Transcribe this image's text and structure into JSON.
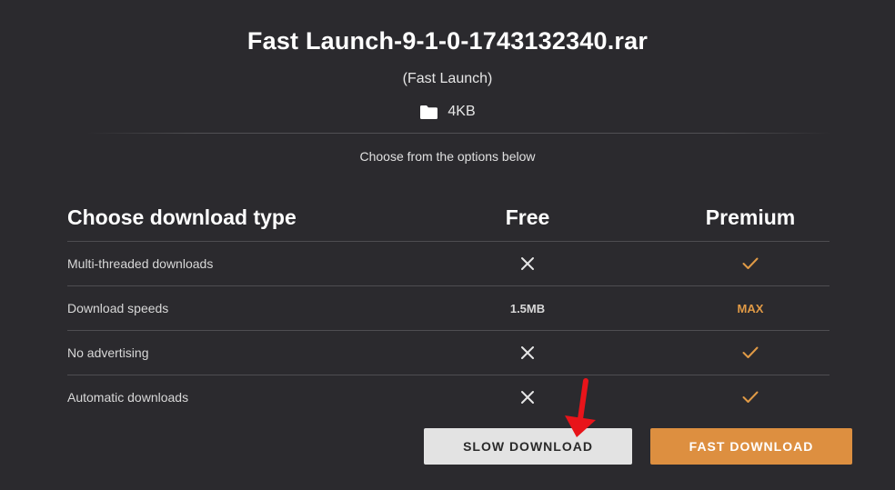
{
  "file": {
    "title": "Fast Launch-9-1-0-1743132340.rar",
    "subtitle": "(Fast Launch)",
    "size": "4KB"
  },
  "choose_text": "Choose from the options below",
  "table": {
    "header": {
      "label": "Choose download type",
      "free": "Free",
      "premium": "Premium"
    },
    "rows": [
      {
        "label": "Multi-threaded downloads",
        "free": "",
        "free_icon": "x-icon",
        "premium": "",
        "premium_icon": "check-icon"
      },
      {
        "label": "Download speeds",
        "free": "1.5MB",
        "free_icon": "",
        "premium": "MAX",
        "premium_icon": ""
      },
      {
        "label": "No advertising",
        "free": "",
        "free_icon": "x-icon",
        "premium": "",
        "premium_icon": "check-icon"
      },
      {
        "label": "Automatic downloads",
        "free": "",
        "free_icon": "x-icon",
        "premium": "",
        "premium_icon": "check-icon"
      }
    ]
  },
  "buttons": {
    "slow": "SLOW DOWNLOAD",
    "fast": "FAST DOWNLOAD"
  },
  "colors": {
    "background": "#2b2a2e",
    "accent": "#dd8f40",
    "check": "#e09a46",
    "annotation_arrow": "#e8141a"
  }
}
